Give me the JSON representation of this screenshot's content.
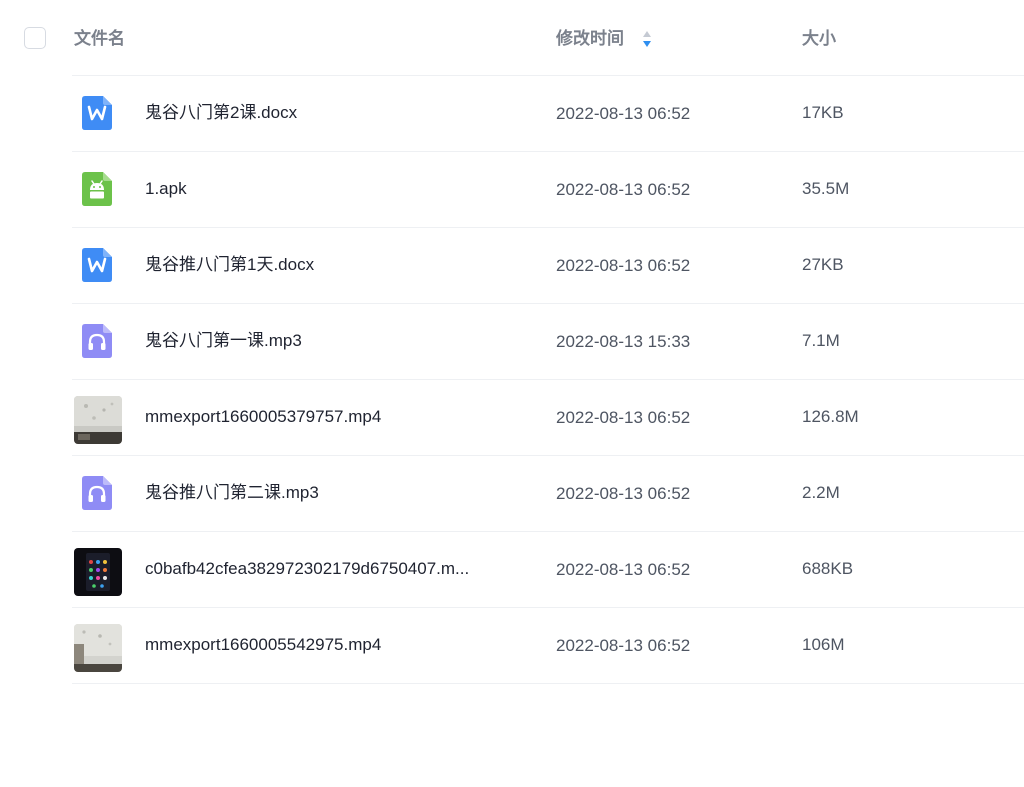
{
  "header": {
    "name_label": "文件名",
    "time_label": "修改时间",
    "size_label": "大小"
  },
  "colors": {
    "doc_blue": "#3f8cf5",
    "apk_green": "#6cc24a",
    "audio_purple": "#8f8cf5",
    "sort_active": "#2f8ff0"
  },
  "files": [
    {
      "name": "鬼谷八门第2课.docx",
      "time": "2022-08-13 06:52",
      "size": "17KB",
      "icon": "word-doc-icon"
    },
    {
      "name": "1.apk",
      "time": "2022-08-13 06:52",
      "size": "35.5M",
      "icon": "android-apk-icon"
    },
    {
      "name": "鬼谷推八门第1天.docx",
      "time": "2022-08-13 06:52",
      "size": "27KB",
      "icon": "word-doc-icon"
    },
    {
      "name": "鬼谷八门第一课.mp3",
      "time": "2022-08-13 15:33",
      "size": "7.1M",
      "icon": "audio-file-icon"
    },
    {
      "name": "mmexport1660005379757.mp4",
      "time": "2022-08-13 06:52",
      "size": "126.8M",
      "icon": "video-thumbnail"
    },
    {
      "name": "鬼谷推八门第二课.mp3",
      "time": "2022-08-13 06:52",
      "size": "2.2M",
      "icon": "audio-file-icon"
    },
    {
      "name": "c0bafb42cfea382972302179d6750407.m...",
      "time": "2022-08-13 06:52",
      "size": "688KB",
      "icon": "video-thumbnail"
    },
    {
      "name": "mmexport1660005542975.mp4",
      "time": "2022-08-13 06:52",
      "size": "106M",
      "icon": "video-thumbnail"
    }
  ]
}
